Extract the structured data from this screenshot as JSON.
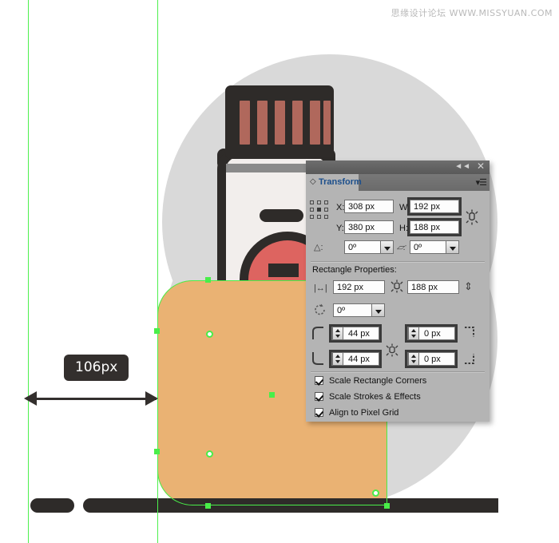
{
  "watermark": {
    "text": "思缘设计论坛  WWW.MISSYUAN.COM"
  },
  "measurement": {
    "label": "106px"
  },
  "panel": {
    "title": "Transform",
    "collapse_icon": "◄◄",
    "close_icon": "✕",
    "menu_icon": "▾☰",
    "tab_diamond_icon": "◇",
    "fields": {
      "x_label": "X:",
      "x_value": "308 px",
      "y_label": "Y:",
      "y_value": "380 px",
      "w_label": "W:",
      "w_value": "192 px",
      "h_label": "H:",
      "h_value": "188 px",
      "rotate_value": "0º",
      "shear_value": "0º"
    },
    "section_title": "Rectangle Properties:",
    "rect": {
      "width_value": "192 px",
      "height_value": "188 px",
      "rotate_value": "0º",
      "corner_tl_value": "44 px",
      "corner_tr_value": "0 px",
      "corner_bl_value": "44 px",
      "corner_br_value": "0 px"
    },
    "checkboxes": [
      {
        "label": "Scale Rectangle Corners",
        "checked": true
      },
      {
        "label": "Scale Strokes & Effects",
        "checked": true
      },
      {
        "label": "Align to Pixel Grid",
        "checked": true
      }
    ]
  },
  "colors": {
    "panel_bg": "#b4b4b4",
    "orange": "#eab273",
    "guide_green": "#4df04d",
    "selection_green": "#49ee49",
    "dark": "#2e2b29",
    "red_label": "#dd6460",
    "cap_slot": "#b0685c",
    "circle_gray": "#d9d9d9",
    "tab_text": "#1c4f8c"
  }
}
